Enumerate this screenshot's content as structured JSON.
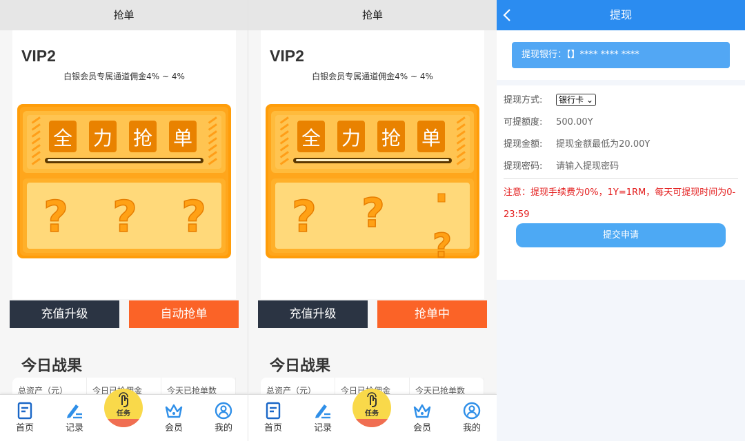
{
  "grab": {
    "header_title": "抢单",
    "vip_level": "VIP2",
    "vip_desc": "白银会员专属通道佣金4% ~ 4%",
    "machine": {
      "title_chars": [
        "全",
        "力",
        "抢",
        "单"
      ],
      "slot_symbol": "?"
    },
    "recharge_label": "充值升级",
    "auto_label": "自动抢单",
    "grabbing_label": "抢单中",
    "today_title": "今日战果",
    "stats_labels": [
      "总资产（元）",
      "今日已抢佣金",
      "今天已抢单数"
    ]
  },
  "tabbar": {
    "home": "首页",
    "records": "记录",
    "task": "任务",
    "member": "会员",
    "mine": "我的"
  },
  "withdraw": {
    "header_title": "提现",
    "bank_label": "提现银行：【】**** **** ****",
    "method_label": "提现方式:",
    "method_value": "银行卡",
    "available_label": "可提额度:",
    "available_value": "500.00Y",
    "amount_label": "提现金额:",
    "amount_placeholder": "提现金额最低为20.00Y",
    "password_label": "提现密码:",
    "password_placeholder": "请输入提现密码",
    "notice": "注意：提现手续费为0%，1Y=1RM，每天可提现时间为0-23:59",
    "submit_label": "提交申请"
  },
  "colors": {
    "blue_header": "#2b8cf0",
    "dark_button": "#2b3443",
    "orange_button": "#fb6327",
    "notice_red": "#e31b1b"
  }
}
